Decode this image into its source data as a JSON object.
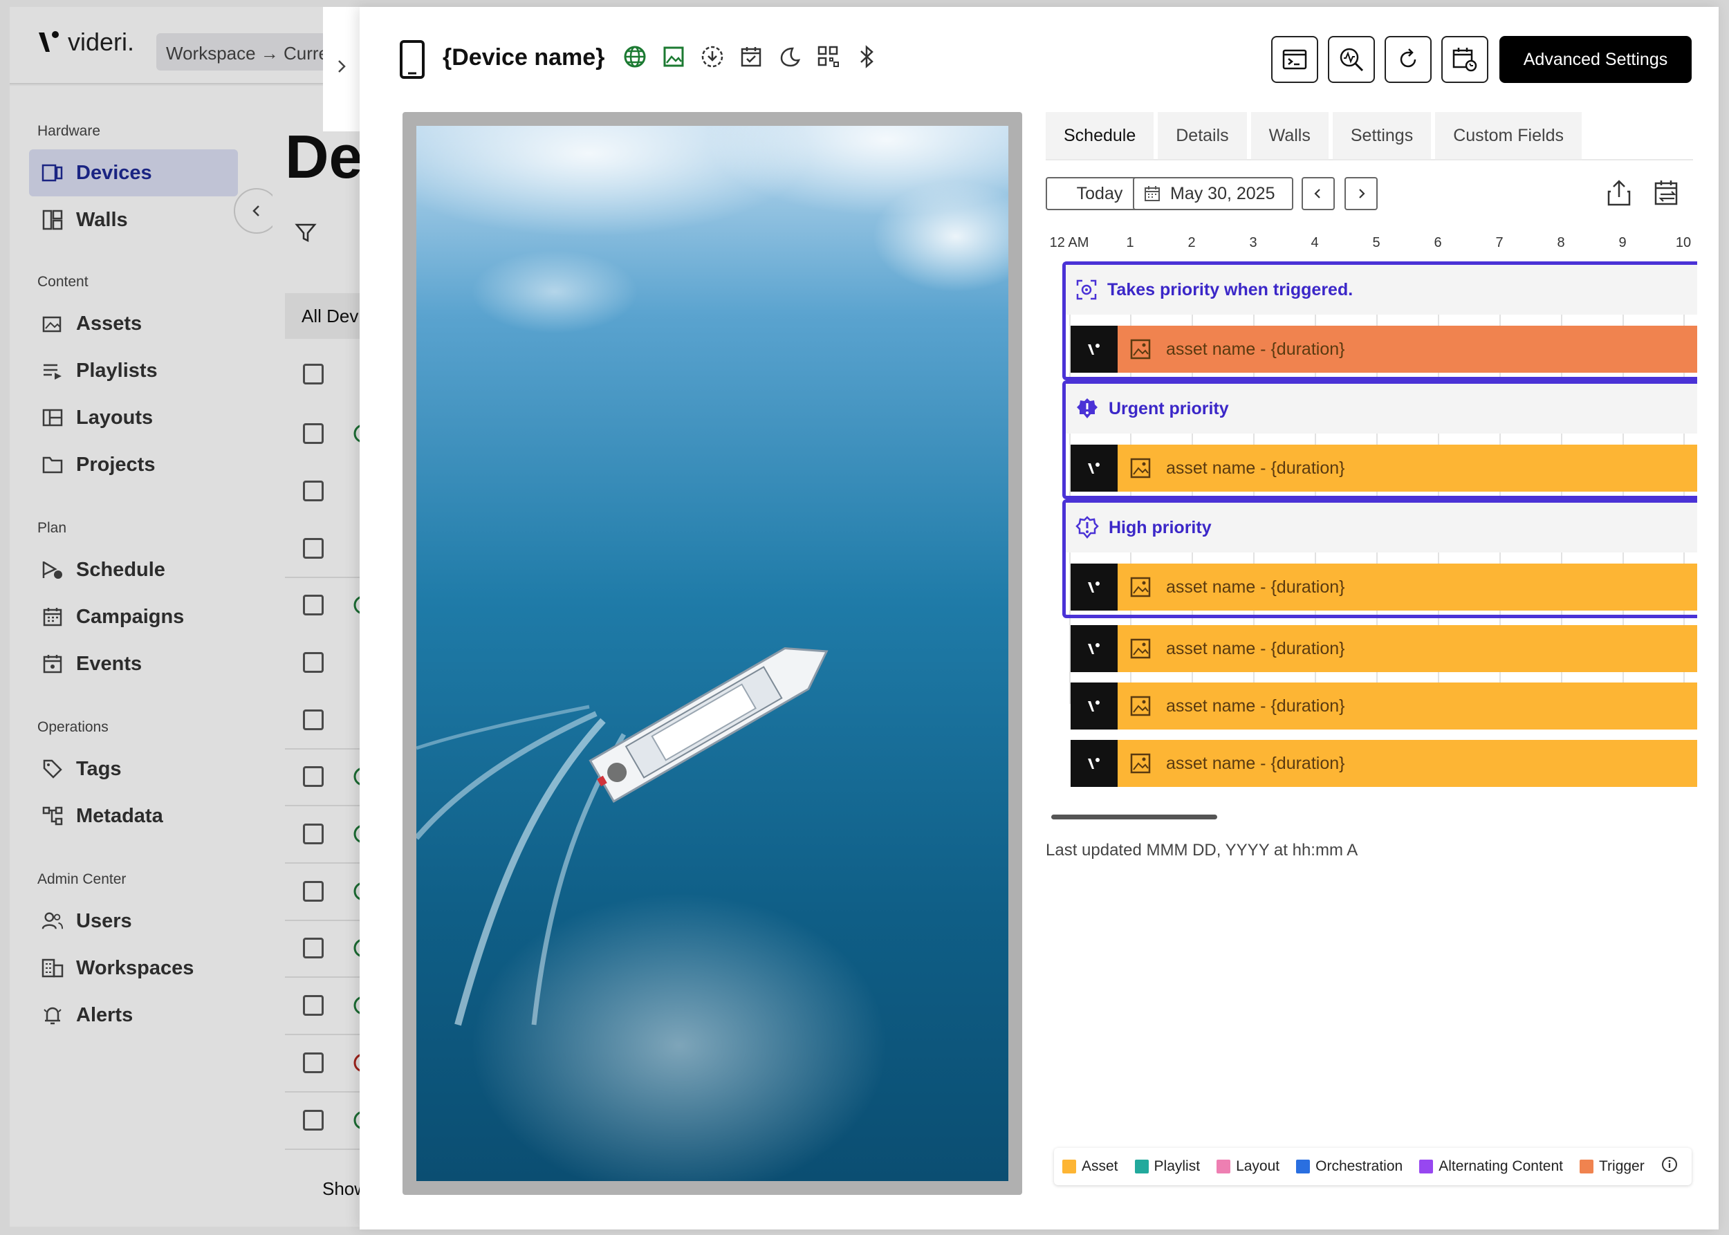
{
  "app": {
    "logo_mark": "\\'",
    "logo_word": "videri.",
    "workspace_breadcrumb": "Workspace → Current"
  },
  "sidebar": {
    "sections": [
      {
        "label": "Hardware",
        "items": [
          {
            "label": "Devices",
            "icon": "devices-icon",
            "active": true
          },
          {
            "label": "Walls",
            "icon": "walls-icon"
          }
        ]
      },
      {
        "label": "Content",
        "items": [
          {
            "label": "Assets",
            "icon": "assets-icon"
          },
          {
            "label": "Playlists",
            "icon": "playlists-icon"
          },
          {
            "label": "Layouts",
            "icon": "layouts-icon"
          },
          {
            "label": "Projects",
            "icon": "folder-icon"
          }
        ]
      },
      {
        "label": "Plan",
        "items": [
          {
            "label": "Schedule",
            "icon": "schedule-icon"
          },
          {
            "label": "Campaigns",
            "icon": "calendar-icon"
          },
          {
            "label": "Events",
            "icon": "event-icon"
          }
        ]
      },
      {
        "label": "Operations",
        "items": [
          {
            "label": "Tags",
            "icon": "tag-icon"
          },
          {
            "label": "Metadata",
            "icon": "metadata-icon"
          }
        ]
      },
      {
        "label": "Admin Center",
        "items": [
          {
            "label": "Users",
            "icon": "users-icon"
          },
          {
            "label": "Workspaces",
            "icon": "workspaces-icon"
          },
          {
            "label": "Alerts",
            "icon": "alert-icon"
          }
        ]
      }
    ]
  },
  "devices_page": {
    "title": "De",
    "all_devices_tab": "All Devi",
    "show_label": "Show"
  },
  "drawer": {
    "device_name": "{Device name}",
    "status_icons": [
      "globe-icon",
      "image-icon",
      "download-icon",
      "calendar-check-icon",
      "moon-icon",
      "qr-icon",
      "bluetooth-icon"
    ],
    "toolbar": [
      "terminal-icon",
      "diagnostics-icon",
      "refresh-icon",
      "calendar-reset-icon"
    ],
    "advanced_settings_label": "Advanced Settings"
  },
  "tabs": [
    {
      "label": "Schedule",
      "active": true
    },
    {
      "label": "Details"
    },
    {
      "label": "Walls"
    },
    {
      "label": "Settings"
    },
    {
      "label": "Custom Fields"
    }
  ],
  "date_controls": {
    "today_label": "Today",
    "date": "May 30, 2025"
  },
  "timeline": {
    "hours": [
      "12 AM",
      "1",
      "2",
      "3",
      "4",
      "5",
      "6",
      "7",
      "8",
      "9",
      "10"
    ],
    "groups": [
      {
        "label": "Takes priority when triggered.",
        "icon": "trigger-icon",
        "color": "#f0834f",
        "assets": [
          "asset name - {duration}"
        ]
      },
      {
        "label": "Urgent priority",
        "icon": "urgent-icon",
        "color": "#fdb534",
        "assets": [
          "asset name - {duration}"
        ]
      },
      {
        "label": "High priority",
        "icon": "high-priority-icon",
        "color": "#fdb534",
        "assets": [
          "asset name - {duration}"
        ]
      }
    ],
    "ungrouped_assets": [
      "asset name - {duration}",
      "asset name - {duration}",
      "asset name - {duration}"
    ],
    "ungrouped_color": "#fdb534"
  },
  "last_updated": "Last updated MMM DD, YYYY at hh:mm A",
  "legend": [
    {
      "label": "Asset",
      "color": "#fdb534"
    },
    {
      "label": "Playlist",
      "color": "#22a99c"
    },
    {
      "label": "Layout",
      "color": "#ee7fb2"
    },
    {
      "label": "Orchestration",
      "color": "#2a6fe0"
    },
    {
      "label": "Alternating Content",
      "color": "#9747f0"
    },
    {
      "label": "Trigger",
      "color": "#f0834f"
    }
  ]
}
